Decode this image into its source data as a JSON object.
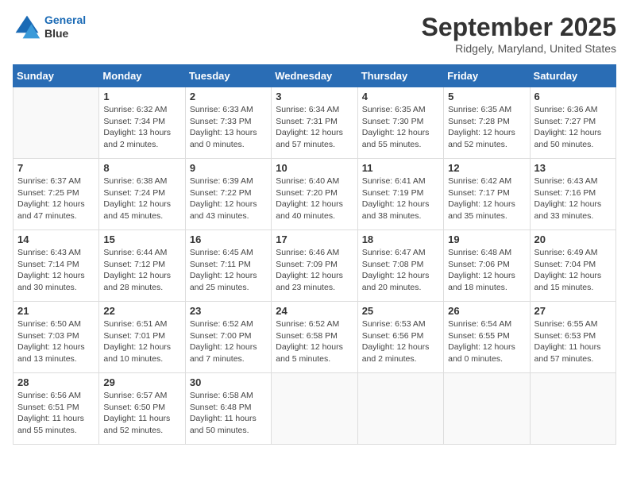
{
  "header": {
    "logo_line1": "General",
    "logo_line2": "Blue",
    "month": "September 2025",
    "location": "Ridgely, Maryland, United States"
  },
  "days_of_week": [
    "Sunday",
    "Monday",
    "Tuesday",
    "Wednesday",
    "Thursday",
    "Friday",
    "Saturday"
  ],
  "weeks": [
    [
      {
        "day": null
      },
      {
        "day": "1",
        "sunrise": "Sunrise: 6:32 AM",
        "sunset": "Sunset: 7:34 PM",
        "daylight": "Daylight: 13 hours and 2 minutes."
      },
      {
        "day": "2",
        "sunrise": "Sunrise: 6:33 AM",
        "sunset": "Sunset: 7:33 PM",
        "daylight": "Daylight: 13 hours and 0 minutes."
      },
      {
        "day": "3",
        "sunrise": "Sunrise: 6:34 AM",
        "sunset": "Sunset: 7:31 PM",
        "daylight": "Daylight: 12 hours and 57 minutes."
      },
      {
        "day": "4",
        "sunrise": "Sunrise: 6:35 AM",
        "sunset": "Sunset: 7:30 PM",
        "daylight": "Daylight: 12 hours and 55 minutes."
      },
      {
        "day": "5",
        "sunrise": "Sunrise: 6:35 AM",
        "sunset": "Sunset: 7:28 PM",
        "daylight": "Daylight: 12 hours and 52 minutes."
      },
      {
        "day": "6",
        "sunrise": "Sunrise: 6:36 AM",
        "sunset": "Sunset: 7:27 PM",
        "daylight": "Daylight: 12 hours and 50 minutes."
      }
    ],
    [
      {
        "day": "7",
        "sunrise": "Sunrise: 6:37 AM",
        "sunset": "Sunset: 7:25 PM",
        "daylight": "Daylight: 12 hours and 47 minutes."
      },
      {
        "day": "8",
        "sunrise": "Sunrise: 6:38 AM",
        "sunset": "Sunset: 7:24 PM",
        "daylight": "Daylight: 12 hours and 45 minutes."
      },
      {
        "day": "9",
        "sunrise": "Sunrise: 6:39 AM",
        "sunset": "Sunset: 7:22 PM",
        "daylight": "Daylight: 12 hours and 43 minutes."
      },
      {
        "day": "10",
        "sunrise": "Sunrise: 6:40 AM",
        "sunset": "Sunset: 7:20 PM",
        "daylight": "Daylight: 12 hours and 40 minutes."
      },
      {
        "day": "11",
        "sunrise": "Sunrise: 6:41 AM",
        "sunset": "Sunset: 7:19 PM",
        "daylight": "Daylight: 12 hours and 38 minutes."
      },
      {
        "day": "12",
        "sunrise": "Sunrise: 6:42 AM",
        "sunset": "Sunset: 7:17 PM",
        "daylight": "Daylight: 12 hours and 35 minutes."
      },
      {
        "day": "13",
        "sunrise": "Sunrise: 6:43 AM",
        "sunset": "Sunset: 7:16 PM",
        "daylight": "Daylight: 12 hours and 33 minutes."
      }
    ],
    [
      {
        "day": "14",
        "sunrise": "Sunrise: 6:43 AM",
        "sunset": "Sunset: 7:14 PM",
        "daylight": "Daylight: 12 hours and 30 minutes."
      },
      {
        "day": "15",
        "sunrise": "Sunrise: 6:44 AM",
        "sunset": "Sunset: 7:12 PM",
        "daylight": "Daylight: 12 hours and 28 minutes."
      },
      {
        "day": "16",
        "sunrise": "Sunrise: 6:45 AM",
        "sunset": "Sunset: 7:11 PM",
        "daylight": "Daylight: 12 hours and 25 minutes."
      },
      {
        "day": "17",
        "sunrise": "Sunrise: 6:46 AM",
        "sunset": "Sunset: 7:09 PM",
        "daylight": "Daylight: 12 hours and 23 minutes."
      },
      {
        "day": "18",
        "sunrise": "Sunrise: 6:47 AM",
        "sunset": "Sunset: 7:08 PM",
        "daylight": "Daylight: 12 hours and 20 minutes."
      },
      {
        "day": "19",
        "sunrise": "Sunrise: 6:48 AM",
        "sunset": "Sunset: 7:06 PM",
        "daylight": "Daylight: 12 hours and 18 minutes."
      },
      {
        "day": "20",
        "sunrise": "Sunrise: 6:49 AM",
        "sunset": "Sunset: 7:04 PM",
        "daylight": "Daylight: 12 hours and 15 minutes."
      }
    ],
    [
      {
        "day": "21",
        "sunrise": "Sunrise: 6:50 AM",
        "sunset": "Sunset: 7:03 PM",
        "daylight": "Daylight: 12 hours and 13 minutes."
      },
      {
        "day": "22",
        "sunrise": "Sunrise: 6:51 AM",
        "sunset": "Sunset: 7:01 PM",
        "daylight": "Daylight: 12 hours and 10 minutes."
      },
      {
        "day": "23",
        "sunrise": "Sunrise: 6:52 AM",
        "sunset": "Sunset: 7:00 PM",
        "daylight": "Daylight: 12 hours and 7 minutes."
      },
      {
        "day": "24",
        "sunrise": "Sunrise: 6:52 AM",
        "sunset": "Sunset: 6:58 PM",
        "daylight": "Daylight: 12 hours and 5 minutes."
      },
      {
        "day": "25",
        "sunrise": "Sunrise: 6:53 AM",
        "sunset": "Sunset: 6:56 PM",
        "daylight": "Daylight: 12 hours and 2 minutes."
      },
      {
        "day": "26",
        "sunrise": "Sunrise: 6:54 AM",
        "sunset": "Sunset: 6:55 PM",
        "daylight": "Daylight: 12 hours and 0 minutes."
      },
      {
        "day": "27",
        "sunrise": "Sunrise: 6:55 AM",
        "sunset": "Sunset: 6:53 PM",
        "daylight": "Daylight: 11 hours and 57 minutes."
      }
    ],
    [
      {
        "day": "28",
        "sunrise": "Sunrise: 6:56 AM",
        "sunset": "Sunset: 6:51 PM",
        "daylight": "Daylight: 11 hours and 55 minutes."
      },
      {
        "day": "29",
        "sunrise": "Sunrise: 6:57 AM",
        "sunset": "Sunset: 6:50 PM",
        "daylight": "Daylight: 11 hours and 52 minutes."
      },
      {
        "day": "30",
        "sunrise": "Sunrise: 6:58 AM",
        "sunset": "Sunset: 6:48 PM",
        "daylight": "Daylight: 11 hours and 50 minutes."
      },
      {
        "day": null
      },
      {
        "day": null
      },
      {
        "day": null
      },
      {
        "day": null
      }
    ]
  ]
}
